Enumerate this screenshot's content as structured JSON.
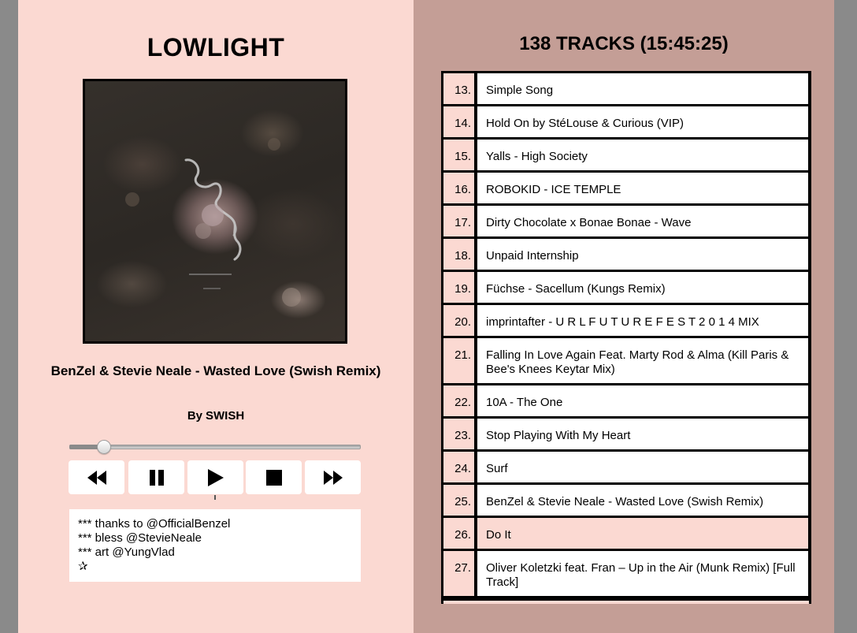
{
  "player": {
    "title": "LOWLIGHT",
    "now_playing": {
      "title": "BenZel & Stevie Neale - Wasted Love (Swish Remix)",
      "by_label": "By",
      "artist": "SWISH"
    },
    "progress_fraction": 0.117,
    "controls": [
      {
        "name": "rewind-icon"
      },
      {
        "name": "pause-icon"
      },
      {
        "name": "play-icon"
      },
      {
        "name": "stop-icon"
      },
      {
        "name": "fast-forward-icon"
      }
    ],
    "notes": [
      "*** thanks to @OfficialBenzel",
      "*** bless @StevieNeale",
      "*** art @YungVlad",
      "✰"
    ]
  },
  "tracklist": {
    "heading": "138 TRACKS (15:45:25)",
    "active_index": 13,
    "tracks": [
      {
        "num": "13.",
        "title": "Simple Song"
      },
      {
        "num": "14.",
        "title": "Hold On by StéLouse & Curious (VIP)"
      },
      {
        "num": "15.",
        "title": "Yalls - High Society"
      },
      {
        "num": "16.",
        "title": "ROBOKID - ICE TEMPLE"
      },
      {
        "num": "17.",
        "title": "Dirty Chocolate x Bonae Bonae - Wave"
      },
      {
        "num": "18.",
        "title": "Unpaid Internship"
      },
      {
        "num": "19.",
        "title": "Füchse - Sacellum (Kungs Remix)"
      },
      {
        "num": "20.",
        "title": "imprintafter - U R L F U T U R E F E S T 2 0 1 4 MIX"
      },
      {
        "num": "21.",
        "title": "Falling In Love Again Feat. Marty Rod & Alma (Kill Paris & Bee's Knees Keytar Mix)"
      },
      {
        "num": "22.",
        "title": "10A - The One"
      },
      {
        "num": "23.",
        "title": "Stop Playing With My Heart"
      },
      {
        "num": "24.",
        "title": "Surf"
      },
      {
        "num": "25.",
        "title": "BenZel & Stevie Neale - Wasted Love (Swish Remix)"
      },
      {
        "num": "26.",
        "title": "Do It"
      },
      {
        "num": "27.",
        "title": "Oliver Koletzki feat. Fran – Up in the Air (Munk Remix) [Full Track]"
      }
    ]
  },
  "colors": {
    "left_panel": "#fbd9d2",
    "right_panel": "#c49e96",
    "highlight": "#fbd9d2",
    "outer": "#8a8a8a"
  }
}
